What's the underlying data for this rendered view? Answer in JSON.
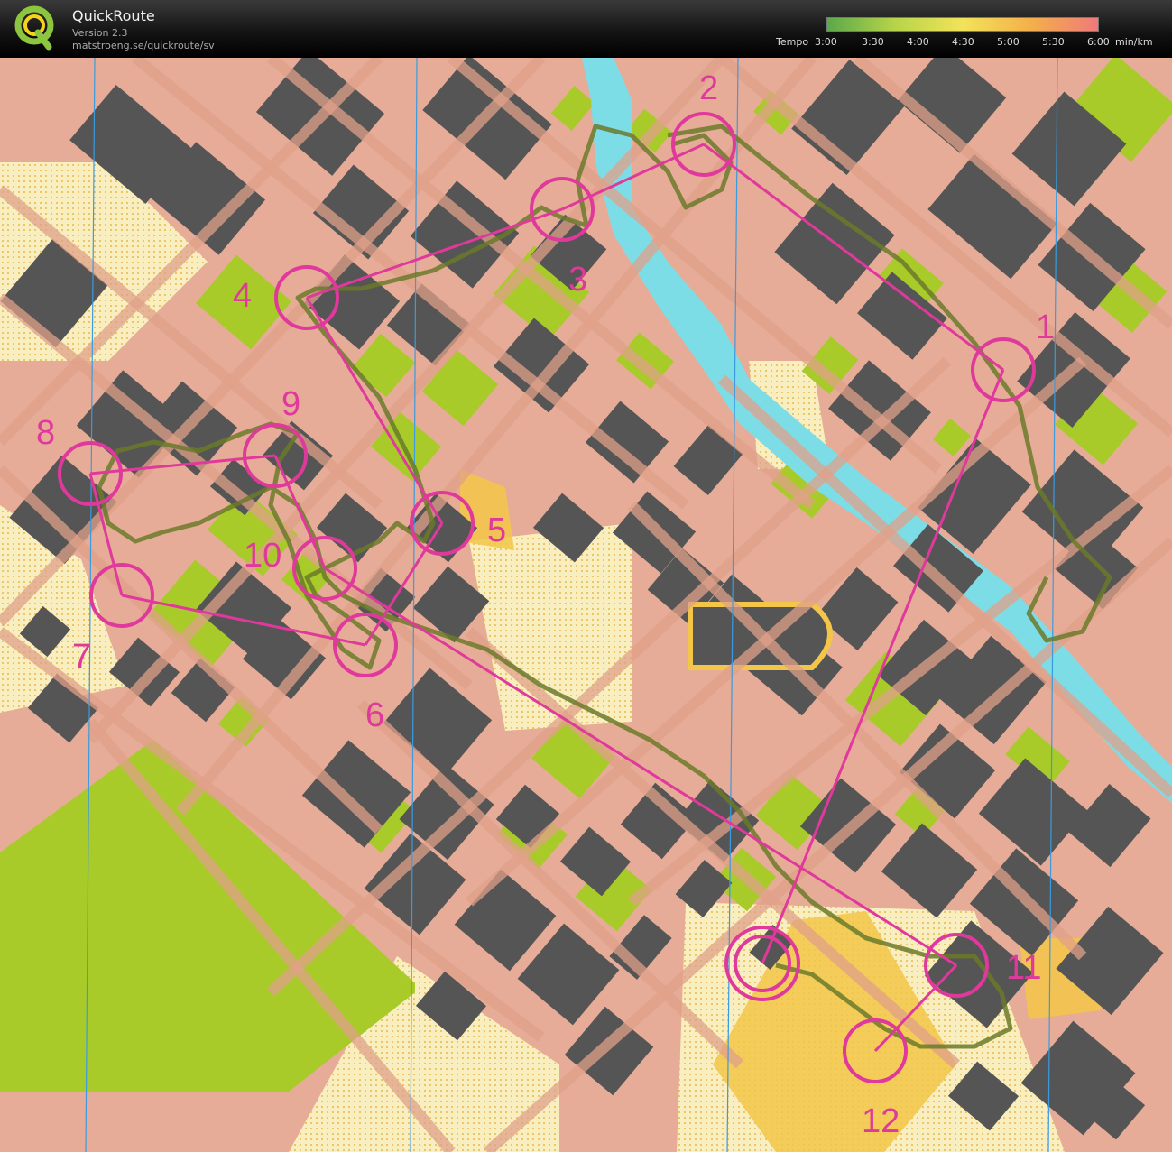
{
  "app": {
    "title": "QuickRoute",
    "version": "Version 2.3",
    "url": "matstroeng.se/quickroute/sv",
    "logo_letter": "Q"
  },
  "tempo_legend": {
    "label": "Tempo",
    "ticks": [
      "3:00",
      "3:30",
      "4:00",
      "4:30",
      "5:00",
      "5:30",
      "6:00"
    ],
    "unit": "min/km",
    "colors": [
      "#5ba84a",
      "#b7d44a",
      "#f2e35a",
      "#f4b04a",
      "#ef7a7a"
    ]
  },
  "map": {
    "colors": {
      "paved": "#e6ac98",
      "building": "#555555",
      "green": "#a8cb2a",
      "open": "#f8eec0",
      "yellow": "#f3c548",
      "water": "#7ddde6",
      "course": "#e0399c",
      "route": "#6b7a2a"
    },
    "controls": [
      {
        "label": "1"
      },
      {
        "label": "2"
      },
      {
        "label": "3"
      },
      {
        "label": "4"
      },
      {
        "label": "5"
      },
      {
        "label": "6"
      },
      {
        "label": "7"
      },
      {
        "label": "8"
      },
      {
        "label": "9"
      },
      {
        "label": "10"
      },
      {
        "label": "11"
      },
      {
        "label": "12"
      }
    ]
  }
}
